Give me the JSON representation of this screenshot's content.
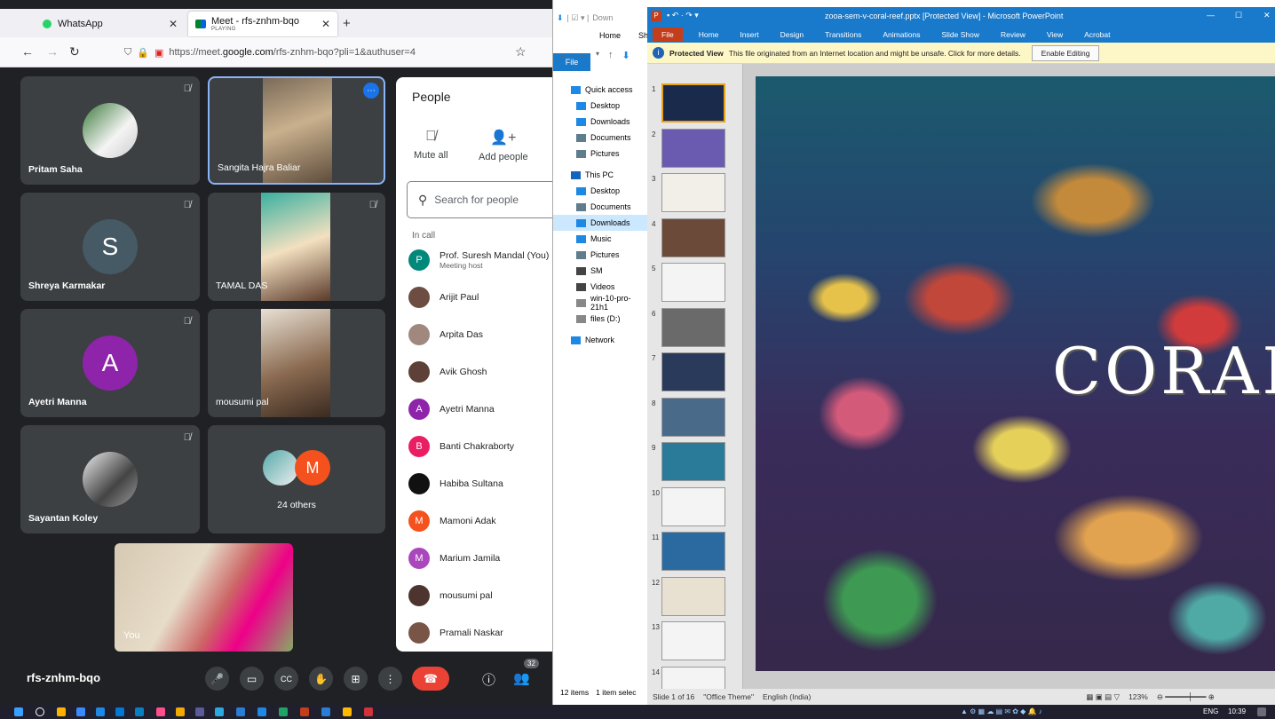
{
  "browser": {
    "tabs": [
      {
        "title": "WhatsApp"
      },
      {
        "title": "Meet - rfs-znhm-bqo",
        "subtitle": "PLAYING"
      }
    ],
    "new_tab": "+",
    "url_prefix": "https://meet.",
    "url_host": "google.com",
    "url_path": "/rfs-znhm-bqo?pli=1&authuser=4"
  },
  "meet": {
    "tiles": [
      {
        "name": "Pritam Saha"
      },
      {
        "name": "Sangita Hajra Baliar"
      },
      {
        "name": "Shreya Karmakar",
        "initial": "S",
        "color": "#455a64"
      },
      {
        "name": "TAMAL DAS"
      },
      {
        "name": "Ayetri Manna",
        "initial": "A",
        "color": "#8e24aa"
      },
      {
        "name": "mousumi pal"
      },
      {
        "name": "Sayantan Koley"
      },
      {
        "name": "24 others",
        "initial": "M",
        "color": "#f4511e"
      }
    ],
    "self_label": "You",
    "meeting_code": "rfs-znhm-bqo",
    "people_count": "32"
  },
  "people_panel": {
    "title": "People",
    "actions": [
      {
        "label": "Mute all",
        "icon": "mic-off-icon"
      },
      {
        "label": "Add people",
        "icon": "person-add-icon"
      }
    ],
    "search_placeholder": "Search for people",
    "section": "In call",
    "participants": [
      {
        "name": "Prof. Suresh Mandal (You)",
        "sub": "Meeting host",
        "initial": "P",
        "color": "#00897b"
      },
      {
        "name": "Arijit Paul",
        "sub": "",
        "initial": "",
        "color": "#6d4c41"
      },
      {
        "name": "Arpita Das",
        "sub": "",
        "initial": "",
        "color": "#a1887f"
      },
      {
        "name": "Avik Ghosh",
        "sub": "",
        "initial": "",
        "color": "#5d4037"
      },
      {
        "name": "Ayetri Manna",
        "sub": "",
        "initial": "A",
        "color": "#8e24aa"
      },
      {
        "name": "Banti Chakraborty",
        "sub": "",
        "initial": "B",
        "color": "#e91e63"
      },
      {
        "name": "Habiba Sultana",
        "sub": "",
        "initial": "",
        "color": "#111111"
      },
      {
        "name": "Mamoni Adak",
        "sub": "",
        "initial": "M",
        "color": "#f4511e"
      },
      {
        "name": "Marium Jamila",
        "sub": "",
        "initial": "M",
        "color": "#ab47bc"
      },
      {
        "name": "mousumi pal",
        "sub": "",
        "initial": "",
        "color": "#4e342e"
      },
      {
        "name": "Pramali Naskar",
        "sub": "",
        "initial": "",
        "color": "#795548"
      }
    ]
  },
  "explorer": {
    "tabs": [
      "File",
      "Home",
      "Sh"
    ],
    "title_fragment": "Down",
    "nav": [
      {
        "label": "Quick access",
        "color": "#1e88e5"
      },
      {
        "label": "Desktop",
        "color": "#1e88e5"
      },
      {
        "label": "Downloads",
        "color": "#1e88e5"
      },
      {
        "label": "Documents",
        "color": "#607d8b"
      },
      {
        "label": "Pictures",
        "color": "#607d8b"
      },
      {
        "label": "This PC",
        "color": "#1565c0"
      },
      {
        "label": "Desktop",
        "color": "#1e88e5"
      },
      {
        "label": "Documents",
        "color": "#607d8b"
      },
      {
        "label": "Downloads",
        "color": "#1e88e5"
      },
      {
        "label": "Music",
        "color": "#1e88e5"
      },
      {
        "label": "Pictures",
        "color": "#607d8b"
      },
      {
        "label": "SM",
        "color": "#444444"
      },
      {
        "label": "Videos",
        "color": "#444444"
      },
      {
        "label": "win-10-pro-21h1",
        "color": "#888888"
      },
      {
        "label": "files (D:)",
        "color": "#888888"
      },
      {
        "label": "Network",
        "color": "#1e88e5"
      }
    ],
    "status_items": "12 items",
    "status_selected": "1 item selec"
  },
  "ppt": {
    "title": "zooa-sem-v-coral-reef.pptx [Protected View] - Microsoft PowerPoint",
    "menu": [
      "File",
      "Home",
      "Insert",
      "Design",
      "Transitions",
      "Animations",
      "Slide Show",
      "Review",
      "View",
      "Acrobat"
    ],
    "protected_label": "Protected View",
    "protected_msg": "This file originated from an Internet location and might be unsafe. Click for more details.",
    "enable_editing": "Enable Editing",
    "thumbnails": [
      "1",
      "2",
      "3",
      "4",
      "5",
      "6",
      "7",
      "8",
      "9",
      "10",
      "11",
      "12",
      "13",
      "14"
    ],
    "slide_title": "CORAL",
    "status_slide": "Slide 1 of 16",
    "status_theme": "\"Office Theme\"",
    "status_lang": "English (India)",
    "zoom": "123%"
  },
  "taskbar": {
    "lang": "ENG",
    "time": "10:39"
  }
}
